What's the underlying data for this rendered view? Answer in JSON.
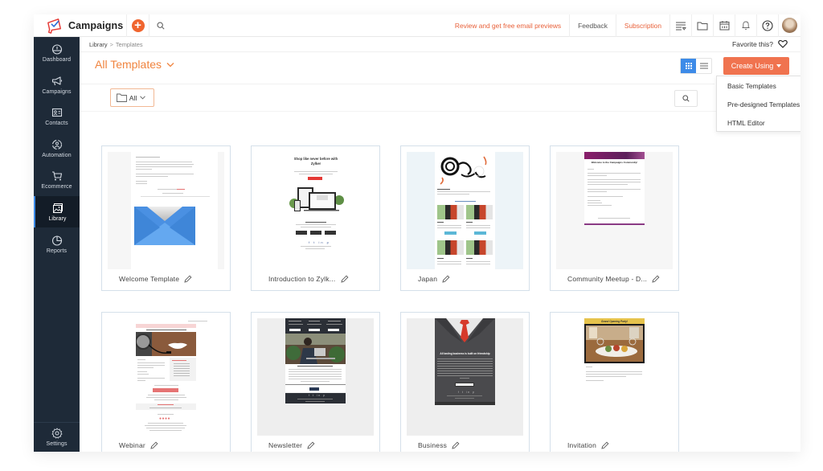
{
  "app": {
    "name": "Campaigns",
    "brand_color": "#f0652f"
  },
  "topbar": {
    "add_icon": "plus-circle-icon",
    "search_icon": "search-icon",
    "links": [
      {
        "label": "Review and get free email previews",
        "color": "#e8613a"
      },
      {
        "label": "Feedback",
        "color": "#555555"
      },
      {
        "label": "Subscription",
        "color": "#e8613a"
      }
    ],
    "icons": [
      "list-filter-icon",
      "folder-icon",
      "calendar-icon",
      "bell-icon",
      "help-icon",
      "avatar"
    ]
  },
  "sidebar": {
    "items": [
      {
        "label": "Dashboard",
        "icon": "gauge-icon",
        "active": false
      },
      {
        "label": "Campaigns",
        "icon": "megaphone-icon",
        "active": false
      },
      {
        "label": "Contacts",
        "icon": "contact-card-icon",
        "active": false
      },
      {
        "label": "Automation",
        "icon": "automation-icon",
        "active": false
      },
      {
        "label": "Ecommerce",
        "icon": "cart-icon",
        "active": false
      },
      {
        "label": "Library",
        "icon": "image-library-icon",
        "active": true
      },
      {
        "label": "Reports",
        "icon": "pie-chart-icon",
        "active": false
      }
    ],
    "settings": {
      "label": "Settings",
      "icon": "gear-icon"
    }
  },
  "breadcrumb": {
    "parent": "Library",
    "separator": ">",
    "current": "Templates"
  },
  "favorite": {
    "label": "Favorite this?",
    "icon": "heart-icon"
  },
  "page": {
    "title": "All Templates",
    "title_color": "#f0843f"
  },
  "view_toggle": {
    "grid_active": true,
    "grid_icon": "grid-icon",
    "list_icon": "list-icon"
  },
  "create_button": {
    "label": "Create Using",
    "color": "#f0734f"
  },
  "create_menu": {
    "items": [
      "Basic Templates",
      "Pre-designed Templates",
      "HTML Editor"
    ]
  },
  "filter": {
    "folder_label": "All",
    "folder_icon": "folder-icon",
    "search_icon": "search-icon"
  },
  "templates": [
    {
      "name": "Welcome Template"
    },
    {
      "name": "Introduction to Zylk..."
    },
    {
      "name": "Japan"
    },
    {
      "name": "Community Meetup - D..."
    },
    {
      "name": "Webinar"
    },
    {
      "name": "Newsletter"
    },
    {
      "name": "Business"
    },
    {
      "name": "Invitation"
    }
  ],
  "thumbnail_text": {
    "intro_heading": "Shop like never before with Zylker",
    "community_heading": "Welcome to the Campaigns Community!",
    "business_heading": "All lasting business is built on friendship",
    "invitation_heading": "Grand Opening Party!"
  }
}
